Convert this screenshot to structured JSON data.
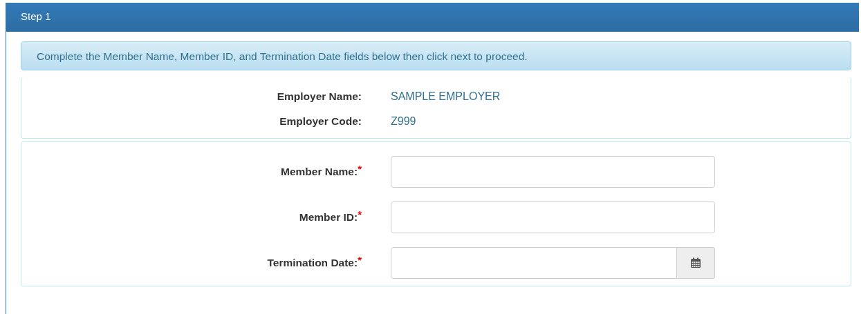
{
  "panel": {
    "title": "Step 1"
  },
  "info_message": "Complete the Member Name, Member ID, and Termination Date fields below then click next to proceed.",
  "employer": [
    {
      "label": "Employer Name:",
      "value": "SAMPLE EMPLOYER"
    },
    {
      "label": "Employer Code:",
      "value": "Z999"
    }
  ],
  "fields": [
    {
      "kind": "text",
      "label": "Member Name:",
      "required_mark": "*"
    },
    {
      "kind": "text",
      "label": "Member ID:",
      "required_mark": "*"
    },
    {
      "kind": "date",
      "label": "Termination Date:",
      "required_mark": "*"
    }
  ]
}
